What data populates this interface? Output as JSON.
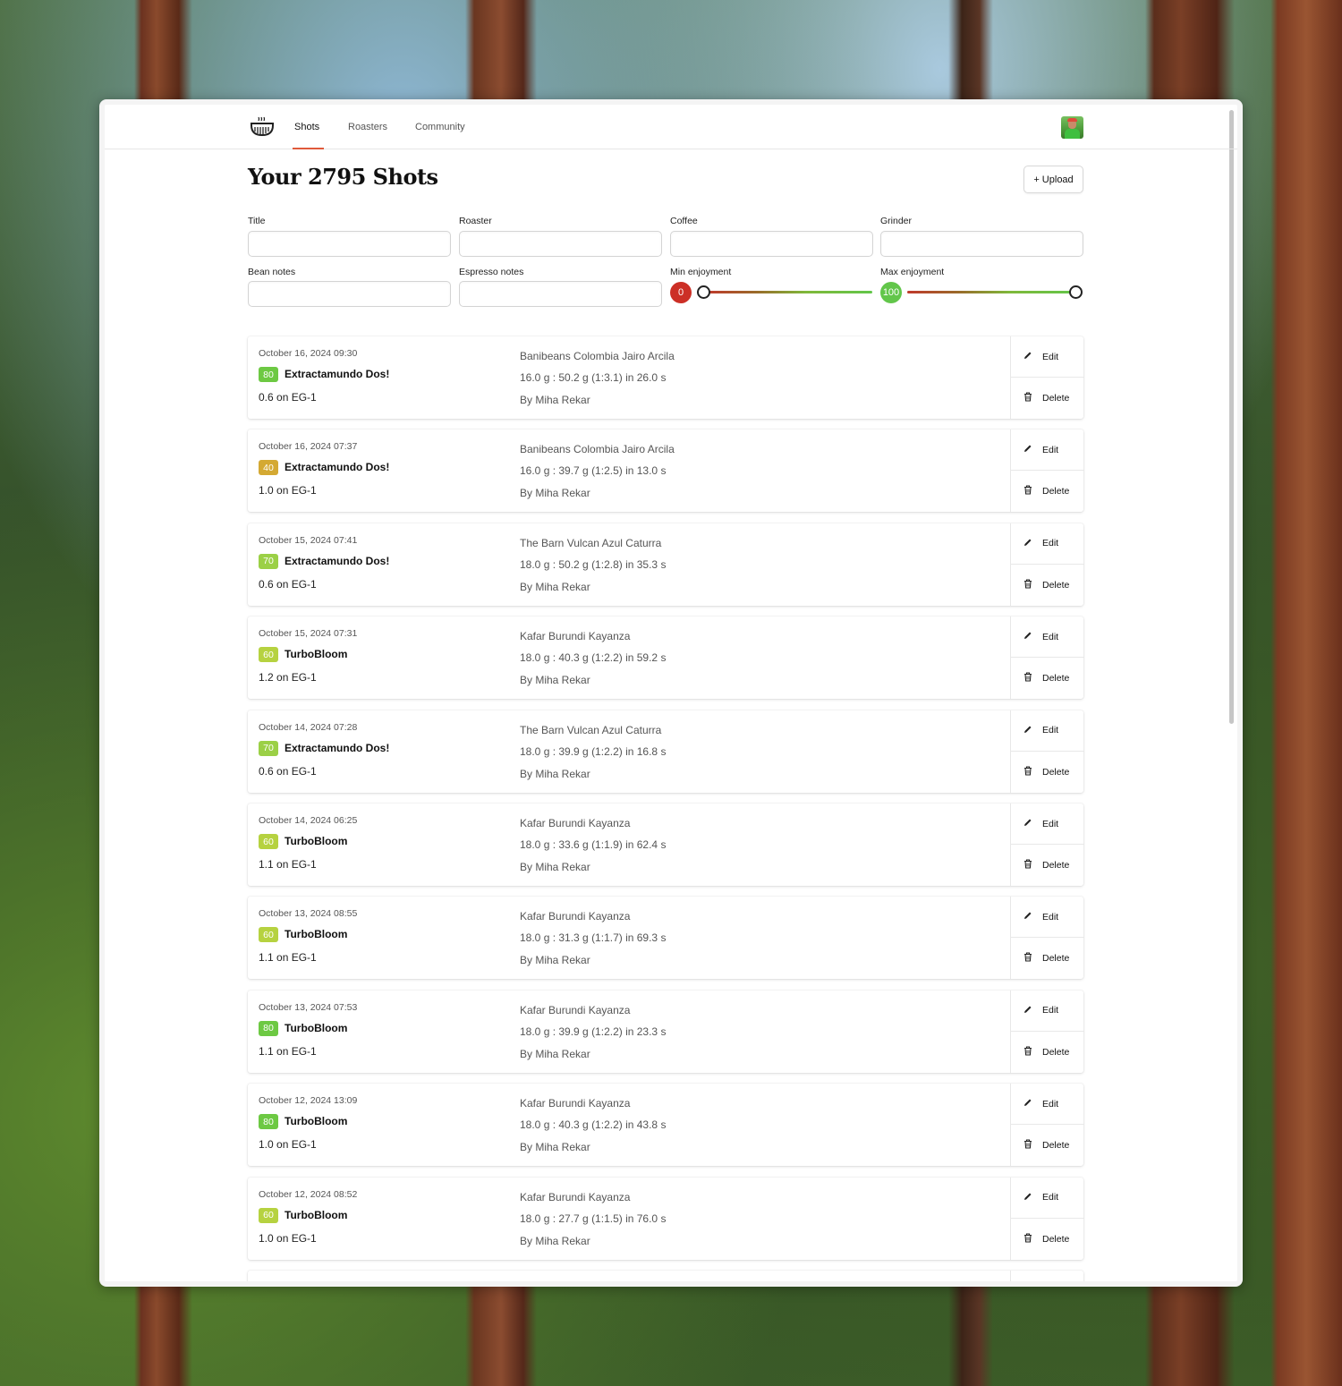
{
  "nav": {
    "tabs": [
      {
        "label": "Shots",
        "active": true
      },
      {
        "label": "Roasters",
        "active": false
      },
      {
        "label": "Community",
        "active": false
      }
    ]
  },
  "header": {
    "title": "Your 2795 Shots",
    "upload_label": "+ Upload"
  },
  "filters": {
    "title_label": "Title",
    "roaster_label": "Roaster",
    "coffee_label": "Coffee",
    "grinder_label": "Grinder",
    "bean_notes_label": "Bean notes",
    "espresso_notes_label": "Espresso notes",
    "min_enjoyment_label": "Min enjoyment",
    "max_enjoyment_label": "Max enjoyment",
    "min_enjoyment_value": "0",
    "max_enjoyment_value": "100",
    "min_color": "#cc2f26",
    "max_color": "#62c64a"
  },
  "actions": {
    "edit_label": "Edit",
    "delete_label": "Delete"
  },
  "shots": [
    {
      "date": "October 16, 2024 09:30",
      "score": "80",
      "score_color": "#6dc943",
      "name": "Extractamundo Dos!",
      "grind": "0.6 on EG-1",
      "coffee": "Banibeans Colombia Jairo Arcila",
      "ratio": "16.0 g : 50.2 g (1:3.1) in 26.0 s",
      "author": "By Miha Rekar"
    },
    {
      "date": "October 16, 2024 07:37",
      "score": "40",
      "score_color": "#d4a933",
      "name": "Extractamundo Dos!",
      "grind": "1.0 on EG-1",
      "coffee": "Banibeans Colombia Jairo Arcila",
      "ratio": "16.0 g : 39.7 g (1:2.5) in 13.0 s",
      "author": "By Miha Rekar"
    },
    {
      "date": "October 15, 2024 07:41",
      "score": "70",
      "score_color": "#9bd046",
      "name": "Extractamundo Dos!",
      "grind": "0.6 on EG-1",
      "coffee": "The Barn Vulcan Azul Caturra",
      "ratio": "18.0 g : 50.2 g (1:2.8) in 35.3 s",
      "author": "By Miha Rekar"
    },
    {
      "date": "October 15, 2024 07:31",
      "score": "60",
      "score_color": "#b6d240",
      "name": "TurboBloom",
      "grind": "1.2 on EG-1",
      "coffee": "Kafar Burundi Kayanza",
      "ratio": "18.0 g : 40.3 g (1:2.2) in 59.2 s",
      "author": "By Miha Rekar"
    },
    {
      "date": "October 14, 2024 07:28",
      "score": "70",
      "score_color": "#9bd046",
      "name": "Extractamundo Dos!",
      "grind": "0.6 on EG-1",
      "coffee": "The Barn Vulcan Azul Caturra",
      "ratio": "18.0 g : 39.9 g (1:2.2) in 16.8 s",
      "author": "By Miha Rekar"
    },
    {
      "date": "October 14, 2024 06:25",
      "score": "60",
      "score_color": "#b6d240",
      "name": "TurboBloom",
      "grind": "1.1 on EG-1",
      "coffee": "Kafar Burundi Kayanza",
      "ratio": "18.0 g : 33.6 g (1:1.9) in 62.4 s",
      "author": "By Miha Rekar"
    },
    {
      "date": "October 13, 2024 08:55",
      "score": "60",
      "score_color": "#b6d240",
      "name": "TurboBloom",
      "grind": "1.1 on EG-1",
      "coffee": "Kafar Burundi Kayanza",
      "ratio": "18.0 g : 31.3 g (1:1.7) in 69.3 s",
      "author": "By Miha Rekar"
    },
    {
      "date": "October 13, 2024 07:53",
      "score": "80",
      "score_color": "#6dc943",
      "name": "TurboBloom",
      "grind": "1.1 on EG-1",
      "coffee": "Kafar Burundi Kayanza",
      "ratio": "18.0 g : 39.9 g (1:2.2) in 23.3 s",
      "author": "By Miha Rekar"
    },
    {
      "date": "October 12, 2024 13:09",
      "score": "80",
      "score_color": "#6dc943",
      "name": "TurboBloom",
      "grind": "1.0 on EG-1",
      "coffee": "Kafar Burundi Kayanza",
      "ratio": "18.0 g : 40.3 g (1:2.2) in 43.8 s",
      "author": "By Miha Rekar"
    },
    {
      "date": "October 12, 2024 08:52",
      "score": "60",
      "score_color": "#b6d240",
      "name": "TurboBloom",
      "grind": "1.0 on EG-1",
      "coffee": "Kafar Burundi Kayanza",
      "ratio": "18.0 g : 27.7 g (1:1.5) in 76.0 s",
      "author": "By Miha Rekar"
    }
  ]
}
